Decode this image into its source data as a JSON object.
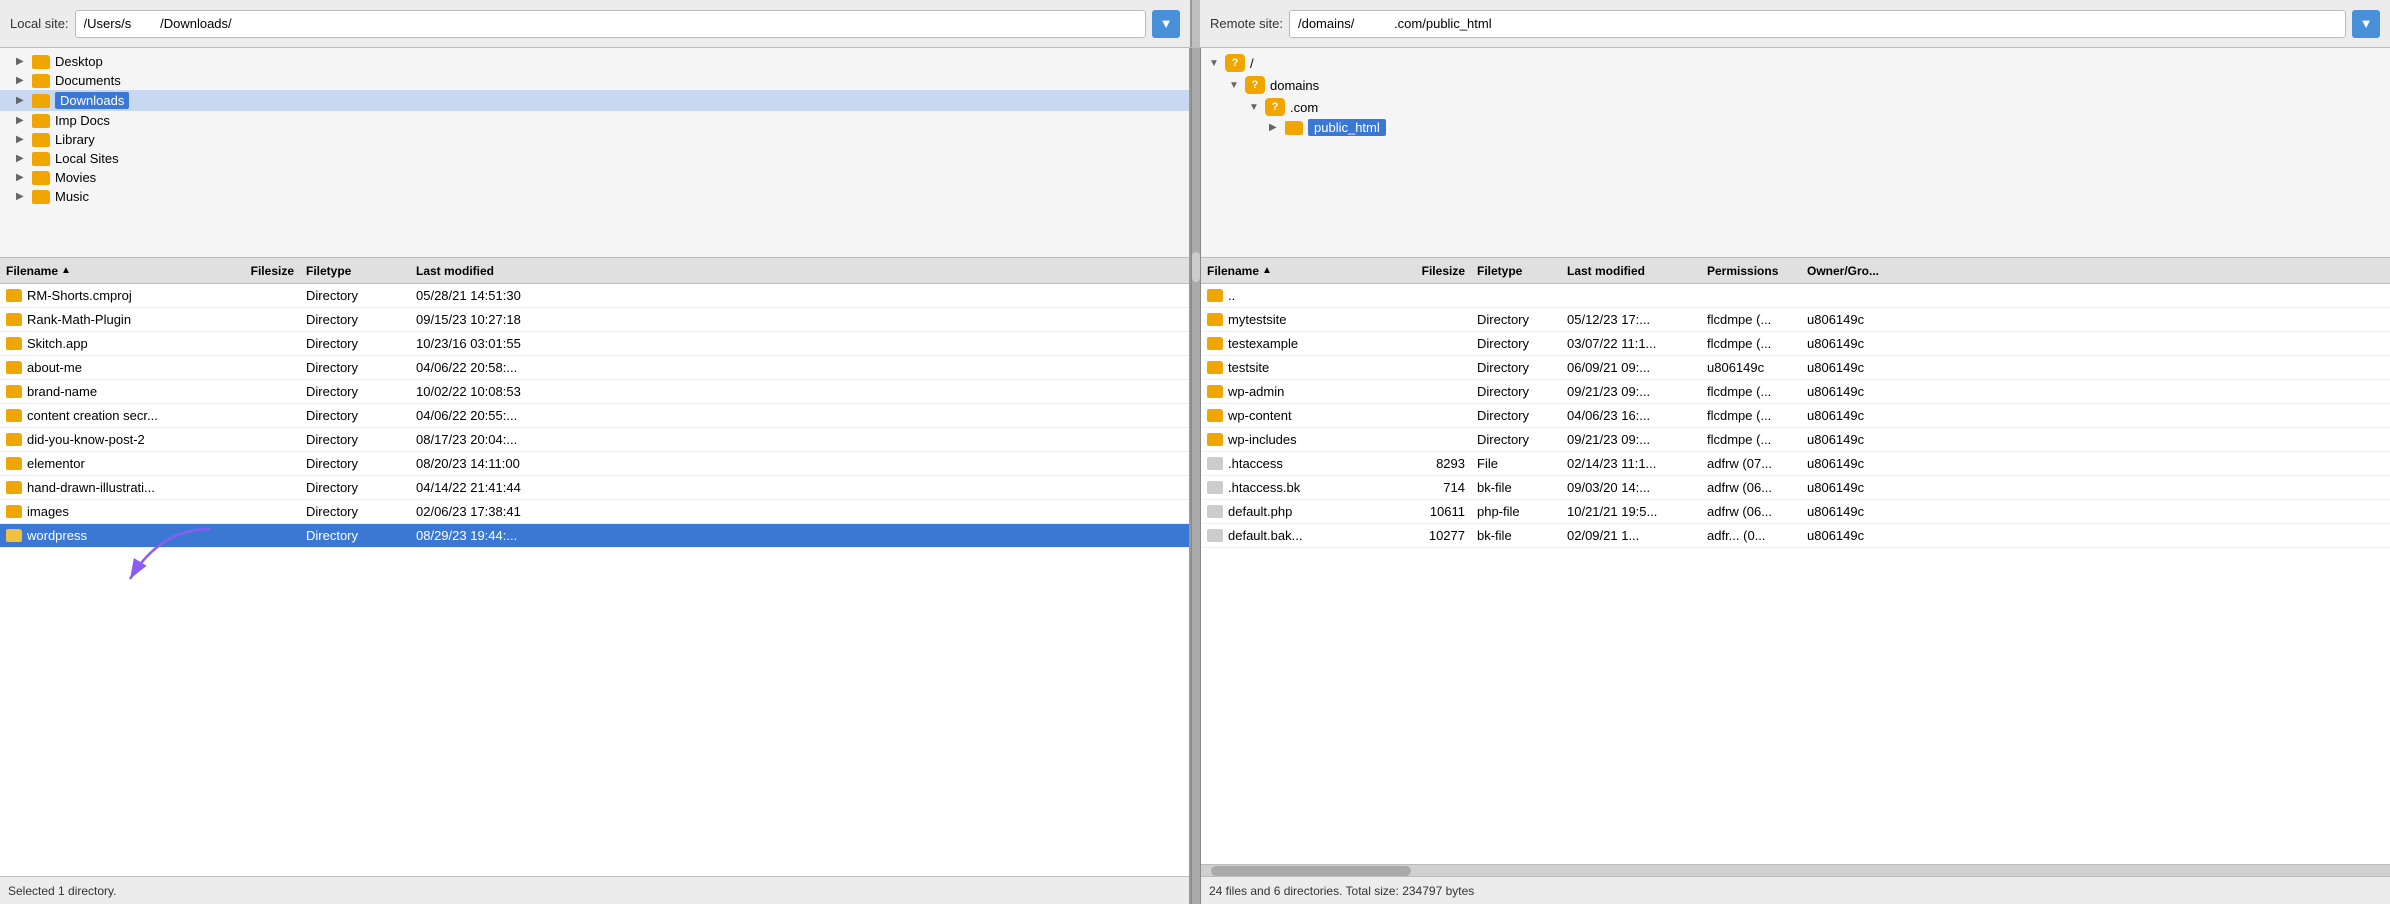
{
  "local": {
    "label": "Local site:",
    "path": "/Users/s        /Downloads/",
    "dropdown_symbol": "▼",
    "tree": [
      {
        "id": "desktop",
        "label": "Desktop",
        "indent": 1,
        "has_arrow": true
      },
      {
        "id": "documents",
        "label": "Documents",
        "indent": 1,
        "has_arrow": true
      },
      {
        "id": "downloads",
        "label": "Downloads",
        "indent": 1,
        "has_arrow": true,
        "selected": true
      },
      {
        "id": "imp-docs",
        "label": "Imp Docs",
        "indent": 1,
        "has_arrow": true
      },
      {
        "id": "library",
        "label": "Library",
        "indent": 1,
        "has_arrow": true
      },
      {
        "id": "local-sites",
        "label": "Local Sites",
        "indent": 1,
        "has_arrow": true
      },
      {
        "id": "movies",
        "label": "Movies",
        "indent": 1,
        "has_arrow": true
      },
      {
        "id": "music",
        "label": "Music",
        "indent": 1,
        "has_arrow": true
      }
    ],
    "columns": [
      {
        "id": "name",
        "label": "Filename",
        "sort": "asc"
      },
      {
        "id": "size",
        "label": "Filesize"
      },
      {
        "id": "type",
        "label": "Filetype"
      },
      {
        "id": "modified",
        "label": "Last modified"
      }
    ],
    "files": [
      {
        "name": "RM-Shorts.cmproj",
        "size": "",
        "type": "Directory",
        "modified": "05/28/21 14:51:30",
        "selected": false
      },
      {
        "name": "Rank-Math-Plugin",
        "size": "",
        "type": "Directory",
        "modified": "09/15/23 10:27:18",
        "selected": false
      },
      {
        "name": "Skitch.app",
        "size": "",
        "type": "Directory",
        "modified": "10/23/16 03:01:55",
        "selected": false
      },
      {
        "name": "about-me",
        "size": "",
        "type": "Directory",
        "modified": "04/06/22 20:58:...",
        "selected": false
      },
      {
        "name": "brand-name",
        "size": "",
        "type": "Directory",
        "modified": "10/02/22 10:08:53",
        "selected": false
      },
      {
        "name": "content creation secr...",
        "size": "",
        "type": "Directory",
        "modified": "04/06/22 20:55:...",
        "selected": false
      },
      {
        "name": "did-you-know-post-2",
        "size": "",
        "type": "Directory",
        "modified": "08/17/23 20:04:...",
        "selected": false
      },
      {
        "name": "elementor",
        "size": "",
        "type": "Directory",
        "modified": "08/20/23 14:11:00",
        "selected": false
      },
      {
        "name": "hand-drawn-illustrati...",
        "size": "",
        "type": "Directory",
        "modified": "04/14/22 21:41:44",
        "selected": false
      },
      {
        "name": "images",
        "size": "",
        "type": "Directory",
        "modified": "02/06/23 17:38:41",
        "selected": false
      },
      {
        "name": "wordpress",
        "size": "",
        "type": "Directory",
        "modified": "08/29/23 19:44:...",
        "selected": true
      }
    ],
    "status": "Selected 1 directory."
  },
  "remote": {
    "label": "Remote site:",
    "path": "/domains/           .com/public_html",
    "dropdown_symbol": "▼",
    "tree": [
      {
        "id": "root",
        "label": "/",
        "indent": 0,
        "has_arrow": true,
        "expanded": true,
        "type": "question"
      },
      {
        "id": "domains",
        "label": "domains",
        "indent": 1,
        "has_arrow": false,
        "expanded": true,
        "type": "question"
      },
      {
        "id": "domain-com",
        "label": "           .com",
        "indent": 2,
        "has_arrow": false,
        "expanded": true,
        "type": "question"
      },
      {
        "id": "public-html",
        "label": "public_html",
        "indent": 3,
        "has_arrow": true,
        "selected": true,
        "type": "folder"
      }
    ],
    "columns": [
      {
        "id": "name",
        "label": "Filename",
        "sort": "asc"
      },
      {
        "id": "size",
        "label": "Filesize"
      },
      {
        "id": "type",
        "label": "Filetype"
      },
      {
        "id": "modified",
        "label": "Last modified"
      },
      {
        "id": "perms",
        "label": "Permissions"
      },
      {
        "id": "owner",
        "label": "Owner/Gro..."
      }
    ],
    "files": [
      {
        "name": "..",
        "size": "",
        "type": "",
        "modified": "",
        "perms": "",
        "owner": "",
        "is_parent": true
      },
      {
        "name": "mytestsite",
        "size": "",
        "type": "Directory",
        "modified": "05/12/23 17:...",
        "perms": "flcdmpe (...",
        "owner": "u806149c"
      },
      {
        "name": "testexample",
        "size": "",
        "type": "Directory",
        "modified": "03/07/22 11:1...",
        "perms": "flcdmpe (...",
        "owner": "u806149c"
      },
      {
        "name": "testsite",
        "size": "",
        "type": "Directory",
        "modified": "06/09/21 09:...",
        "perms": "u806149c",
        "owner": "u806149c"
      },
      {
        "name": "wp-admin",
        "size": "",
        "type": "Directory",
        "modified": "09/21/23 09:...",
        "perms": "flcdmpe (...",
        "owner": "u806149c"
      },
      {
        "name": "wp-content",
        "size": "",
        "type": "Directory",
        "modified": "04/06/23 16:...",
        "perms": "flcdmpe (...",
        "owner": "u806149c"
      },
      {
        "name": "wp-includes",
        "size": "",
        "type": "Directory",
        "modified": "09/21/23 09:...",
        "perms": "flcdmpe (...",
        "owner": "u806149c"
      },
      {
        "name": ".htaccess",
        "size": "8293",
        "type": "File",
        "modified": "02/14/23 11:1...",
        "perms": "adfrw (07...",
        "owner": "u806149c"
      },
      {
        "name": ".htaccess.bk",
        "size": "714",
        "type": "bk-file",
        "modified": "09/03/20 14:...",
        "perms": "adfrw (06...",
        "owner": "u806149c"
      },
      {
        "name": "default.php",
        "size": "10611",
        "type": "php-file",
        "modified": "10/21/21 19:5...",
        "perms": "adfrw (06...",
        "owner": "u806149c"
      },
      {
        "name": "default.bak...",
        "size": "10277",
        "type": "bk-file",
        "modified": "02/09/21 1...",
        "perms": "adfr... (0...",
        "owner": "u806149c"
      }
    ],
    "status": "24 files and 6 directories. Total size: 234797 bytes"
  }
}
